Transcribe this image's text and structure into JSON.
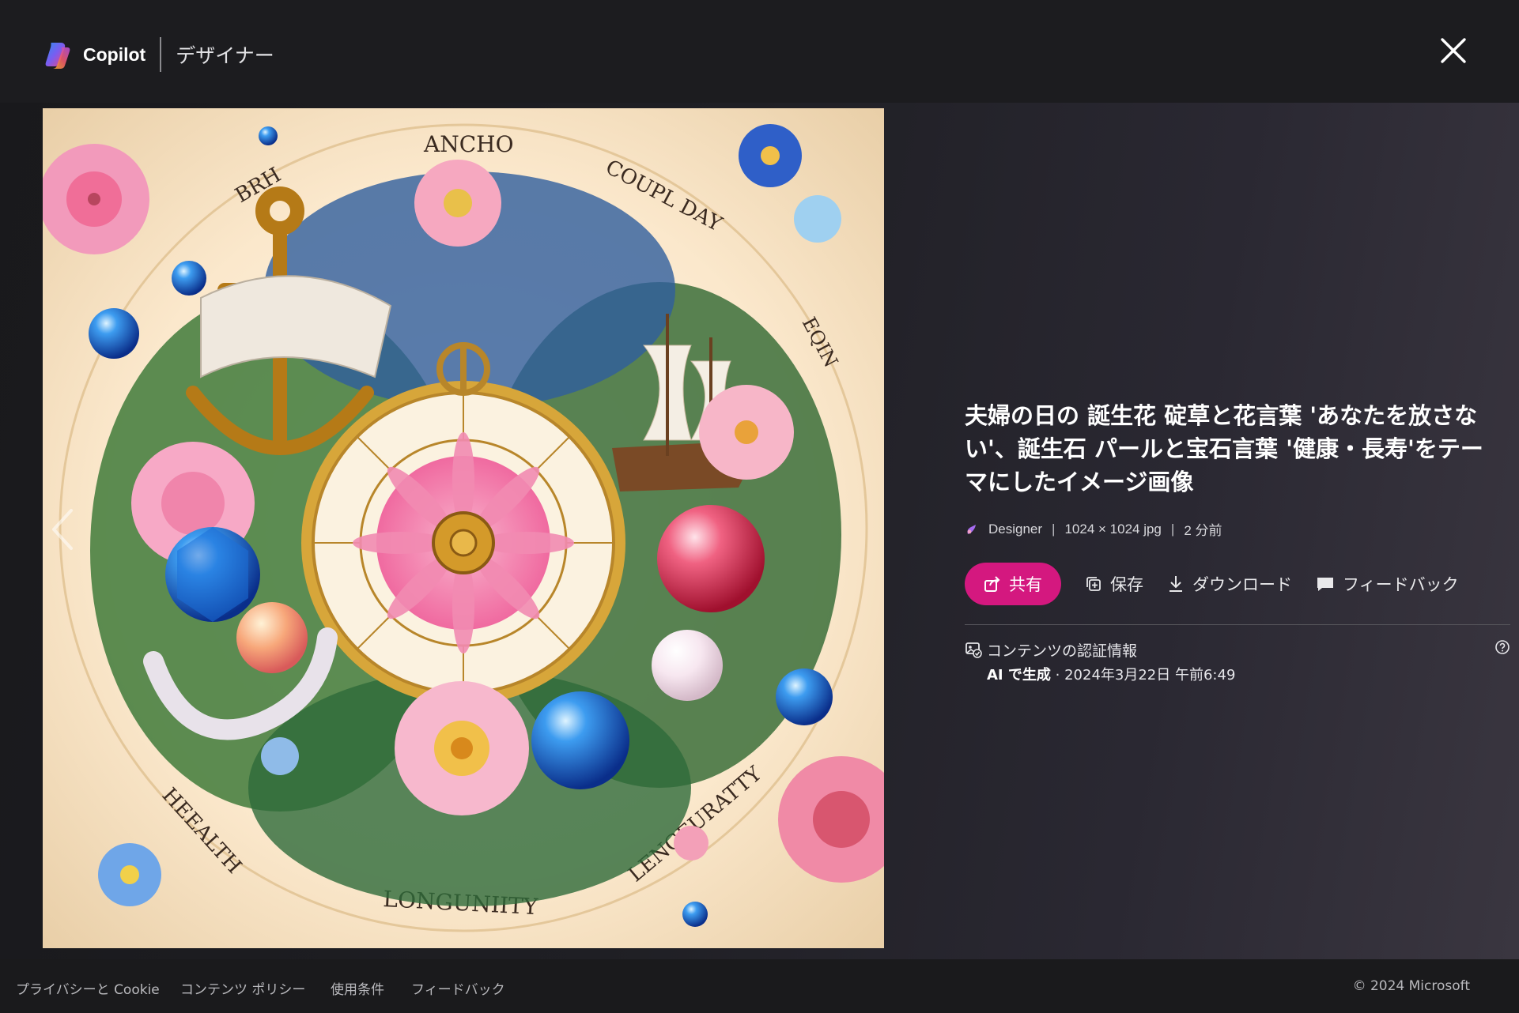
{
  "header": {
    "brand": "Copilot",
    "section": "デザイナー"
  },
  "image": {
    "alt_labels": {
      "top": "ANCHO",
      "top_left": "BRH",
      "top_right": "COUPL DAY",
      "right": "EQIN",
      "bottom": "LONGUNIITY",
      "bottom_left": "HEEALTH",
      "bottom_right": "LENGEURATTY"
    }
  },
  "details": {
    "title": "夫婦の日の 誕生花 碇草と花言葉 'あなたを放さない'、誕生石 パールと宝石言葉 '健康・長寿'をテーマにしたイメージ画像",
    "source": "Designer",
    "dimensions": "1024 × 1024 jpg",
    "age": "2 分前",
    "share_label": "共有",
    "save_label": "保存",
    "download_label": "ダウンロード",
    "feedback_label": "フィードバック",
    "credentials_title": "コンテンツの認証情報",
    "credentials_generated": "AI で生成",
    "credentials_date": "· 2024年3月22日 午前6:49"
  },
  "footer": {
    "privacy": "プライバシーと Cookie",
    "policy": "コンテンツ ポリシー",
    "terms": "使用条件",
    "feedback": "フィードバック",
    "copyright": "© 2024 Microsoft"
  },
  "colors": {
    "accent": "#d4187f",
    "background": "#1f1e22"
  }
}
